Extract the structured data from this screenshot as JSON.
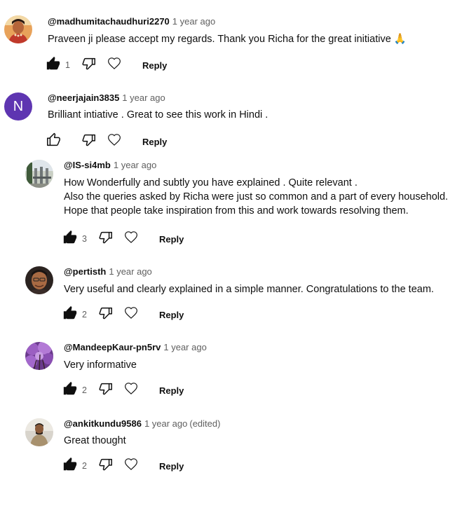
{
  "comments": [
    {
      "author": "@madhumitachaudhuri2270",
      "time": "1 year ago",
      "edited": "",
      "lines": [
        "Praveen ji please accept my regards. Thank you Richa for the great initiative 🙏"
      ],
      "likes": "1",
      "liked": true,
      "reply": "Reply",
      "avatar": "photo-avatar"
    },
    {
      "author": "@neerjajain3835",
      "time": "1 year ago",
      "edited": "",
      "lines": [
        "Brilliant intiative . Great to see this work in Hindi ."
      ],
      "likes": "",
      "liked": false,
      "reply": "Reply",
      "avatar_letter": "N",
      "avatar_color": "#5e35b1"
    },
    {
      "author": "@IS-si4mb",
      "time": "1 year ago",
      "edited": "",
      "lines": [
        "How Wonderfully and subtly you have explained . Quite relevant .",
        "Also the queries asked by Richa were just so common and a part of every household.",
        "Hope that people take inspiration from this and work towards resolving them."
      ],
      "likes": "3",
      "liked": true,
      "reply": "Reply",
      "avatar": "photo-avatar"
    },
    {
      "author": "@pertisth",
      "time": "1 year ago",
      "edited": "",
      "lines": [
        "Very useful and clearly explained in a simple manner.  Congratulations to the team."
      ],
      "likes": "2",
      "liked": true,
      "reply": "Reply",
      "avatar": "photo-avatar"
    },
    {
      "author": "@MandeepKaur-pn5rv",
      "time": "1 year ago",
      "edited": "",
      "lines": [
        "Very informative"
      ],
      "likes": "2",
      "liked": true,
      "reply": "Reply",
      "avatar": "photo-avatar"
    },
    {
      "author": "@ankitkundu9586",
      "time": "1 year ago",
      "edited": "(edited)",
      "lines": [
        "Great thought"
      ],
      "likes": "2",
      "liked": true,
      "reply": "Reply",
      "avatar": "photo-avatar"
    }
  ],
  "colors": {
    "text": "#0f0f0f",
    "secondary": "#606060",
    "letter_avatar": "#5e35b1"
  },
  "icons": [
    "like-filled-icon",
    "like-outline-icon",
    "dislike-icon",
    "heart-icon"
  ]
}
